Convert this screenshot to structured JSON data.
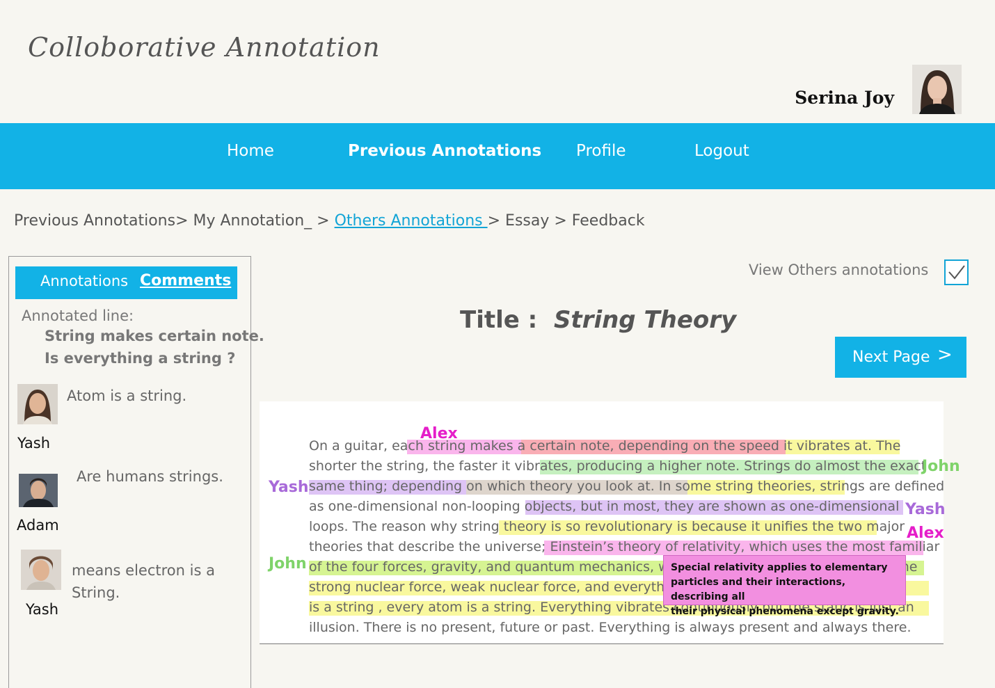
{
  "header": {
    "app_title": "Colloborative Annotation",
    "user_name": "Serina Joy"
  },
  "nav": {
    "items": [
      {
        "label": "Home"
      },
      {
        "label": "Previous Annotations"
      },
      {
        "label": "Profile"
      },
      {
        "label": "Logout"
      }
    ],
    "color": "#12b2e6"
  },
  "breadcrumb": {
    "previous": "Previous Annotations",
    "my": "My Annotation_",
    "others": "Others Annotations ",
    "essay": "Essay",
    "feedback": "Feedback",
    "sep1": "> ",
    "sep2": " > ",
    "sep3": " > "
  },
  "sidebar": {
    "tabs": {
      "annotations": "Annotations",
      "comments": "Comments"
    },
    "annotated_label": "Annotated line:",
    "annotated_lines": [
      "String makes certain note.",
      "Is everything a string ?"
    ],
    "comments": [
      {
        "text": "Atom is a string.",
        "user": "Yash"
      },
      {
        "text": "Are humans strings.",
        "user": "Adam"
      },
      {
        "text": "means electron is a String.",
        "user": "Yash"
      }
    ]
  },
  "main": {
    "view_others_label": "View Others annotations",
    "view_others_checked": true,
    "title_label": "Title :",
    "title_value": "String Theory",
    "next_page_label": "Next Page",
    "next_page_icon": "chevron-right-icon",
    "next_page_glyph": ">",
    "essay_lines": [
      "On a guitar, each string makes a certain note, depending on the speed it vibrates at. The",
      "shorter the string, the faster it vibrates, producing a higher note. Strings do almost the exact",
      "same thing; depending on which theory you look at. In some string theories, strings are defined",
      "as one-dimensional non-looping objects, but in most, they are shown as one-dimensional",
      "loops. The reason why string theory is so revolutionary is because it unifies the two major",
      "theories that describe the universe; Einstein’s theory of relativity, which uses the most familiar",
      "of the four forces, gravity, and quantum mechanics, which uses the three others forces: the",
      "strong nuclear force, weak nuclear force, and everything is a string in string theory. Time",
      "is a string , every atom is a string. Everything vibrates continuously but the static is just an",
      "illusion. There is no present, future or past. Everything is always present and always there."
    ],
    "annotators": [
      {
        "name": "Alex",
        "color": "#e51ec9"
      },
      {
        "name": "John",
        "color": "#7fd36a"
      },
      {
        "name": "Yash",
        "color": "#a86ad9"
      },
      {
        "name": "Yash",
        "color": "#a86ad9"
      },
      {
        "name": "Alex",
        "color": "#e51ec9"
      },
      {
        "name": "John",
        "color": "#7fd36a"
      }
    ],
    "tooltip_lines": [
      "Special relativity applies to elementary",
      "particles and their interactions, describing all",
      "their physical phenomena except gravity."
    ]
  }
}
